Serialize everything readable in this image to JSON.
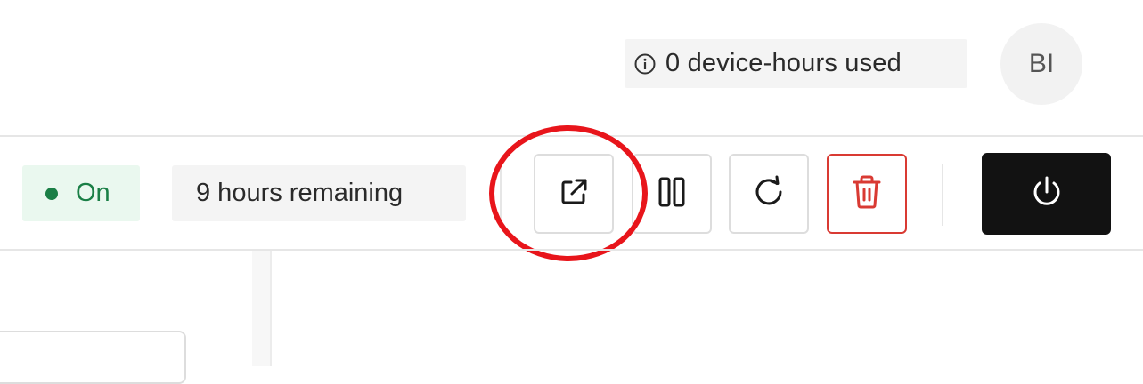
{
  "header": {
    "usage_text": "0 device-hours used",
    "avatar_initials": "BI"
  },
  "toolbar": {
    "status_label": "On",
    "status_color": "#1a7f46",
    "time_remaining": "9 hours remaining",
    "buttons": [
      {
        "name": "open-external",
        "icon": "external-link-icon"
      },
      {
        "name": "pause",
        "icon": "pause-icon"
      },
      {
        "name": "restart",
        "icon": "refresh-icon"
      },
      {
        "name": "delete",
        "icon": "trash-icon",
        "color": "#d93a33"
      },
      {
        "name": "power",
        "icon": "power-icon"
      }
    ],
    "highlight_color": "#e8151b"
  }
}
